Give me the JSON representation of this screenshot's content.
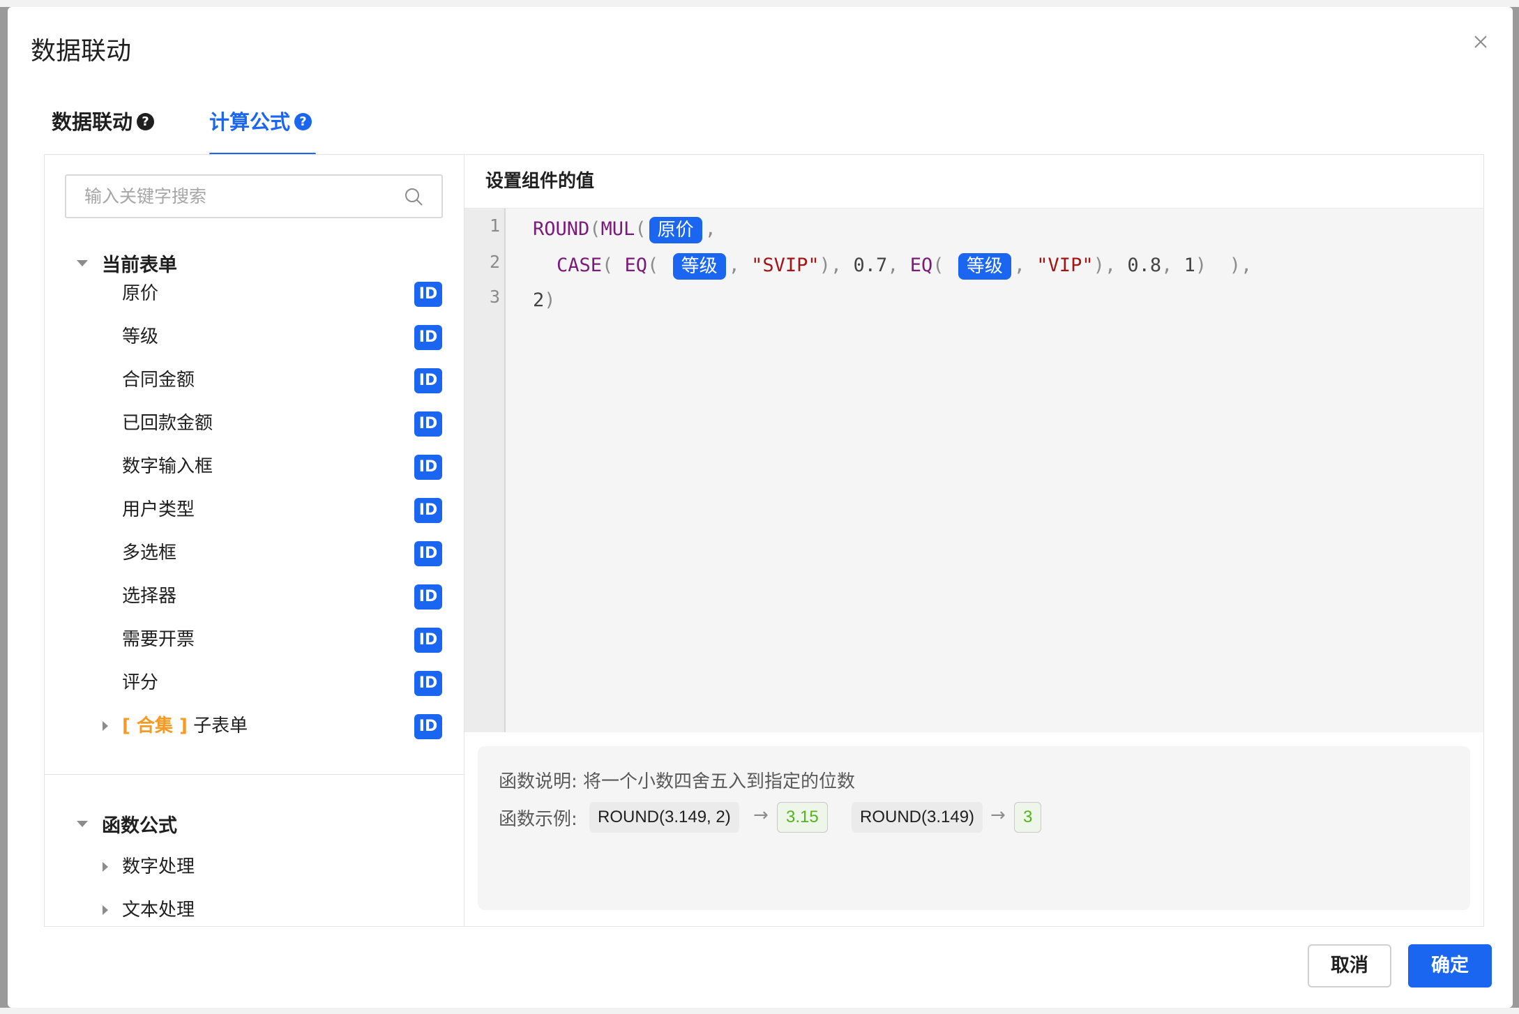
{
  "dialog": {
    "title": "数据联动",
    "tabs": [
      {
        "label": "数据联动",
        "active": false
      },
      {
        "label": "计算公式",
        "active": true
      }
    ],
    "help_glyph": "?"
  },
  "left": {
    "search_placeholder": "输入关键字搜索",
    "current_form": {
      "label": "当前表单",
      "fields": [
        {
          "label": "原价",
          "badge": "ID"
        },
        {
          "label": "等级",
          "badge": "ID"
        },
        {
          "label": "合同金额",
          "badge": "ID"
        },
        {
          "label": "已回款金额",
          "badge": "ID"
        },
        {
          "label": "数字输入框",
          "badge": "ID"
        },
        {
          "label": "用户类型",
          "badge": "ID"
        },
        {
          "label": "多选框",
          "badge": "ID"
        },
        {
          "label": "选择器",
          "badge": "ID"
        },
        {
          "label": "需要开票",
          "badge": "ID"
        },
        {
          "label": "评分",
          "badge": "ID"
        }
      ],
      "subform": {
        "tag": "[ 合集 ]",
        "label": "子表单",
        "badge": "ID"
      }
    },
    "functions": {
      "label": "函数公式",
      "items": [
        {
          "label": "数字处理"
        },
        {
          "label": "文本处理"
        }
      ]
    }
  },
  "right": {
    "section_title": "设置组件的值",
    "line_numbers": [
      "1",
      "2",
      "3"
    ],
    "code": {
      "l1_fn1": "ROUND",
      "l1_p1": "(",
      "l1_fn2": "MUL",
      "l1_p2": "(",
      "l1_tok": "原价",
      "l1_p3": ",",
      "l2_fn1": "CASE",
      "l2_p1": "( ",
      "l2_fn2": "EQ",
      "l2_p2": "( ",
      "l2_tok1": "等级",
      "l2_p3": ", ",
      "l2_s1": "\"SVIP\"",
      "l2_p4": "), ",
      "l2_n1": "0.7",
      "l2_p5": ", ",
      "l2_fn3": "EQ",
      "l2_p6": "( ",
      "l2_tok2": "等级",
      "l2_p7": ", ",
      "l2_s2": "\"VIP\"",
      "l2_p8": "), ",
      "l2_n2": "0.8",
      "l2_p9": ", ",
      "l2_n3": "1",
      "l2_p10": ")  ),",
      "l3_n": "2",
      "l3_p": ")"
    },
    "description": {
      "desc_text": "函数说明: 将一个小数四舍五入到指定的位数",
      "example_label": "函数示例:",
      "example1": "ROUND(3.149, 2)",
      "result1": "3.15",
      "example2": "ROUND(3.149)",
      "result2": "3",
      "arrow": "→"
    }
  },
  "footer": {
    "cancel": "取消",
    "ok": "确定"
  }
}
